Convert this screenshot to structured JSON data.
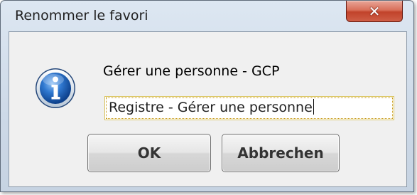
{
  "window": {
    "title": "Renommer le favori",
    "close_glyph": "✕"
  },
  "dialog": {
    "icon": "info-icon",
    "subject": "Gérer une personne - GCP",
    "name_field": {
      "value": "Registre - Gérer une personne",
      "focused": true
    },
    "buttons": {
      "ok_label": "OK",
      "cancel_label": "Abbrechen"
    }
  },
  "colors": {
    "title_bar": "#cdd9e7",
    "close_button": "#c1432b",
    "client_area": "#f0f0f0",
    "info_icon": "#1a5fb4",
    "focus_border": "#d9c35c"
  }
}
